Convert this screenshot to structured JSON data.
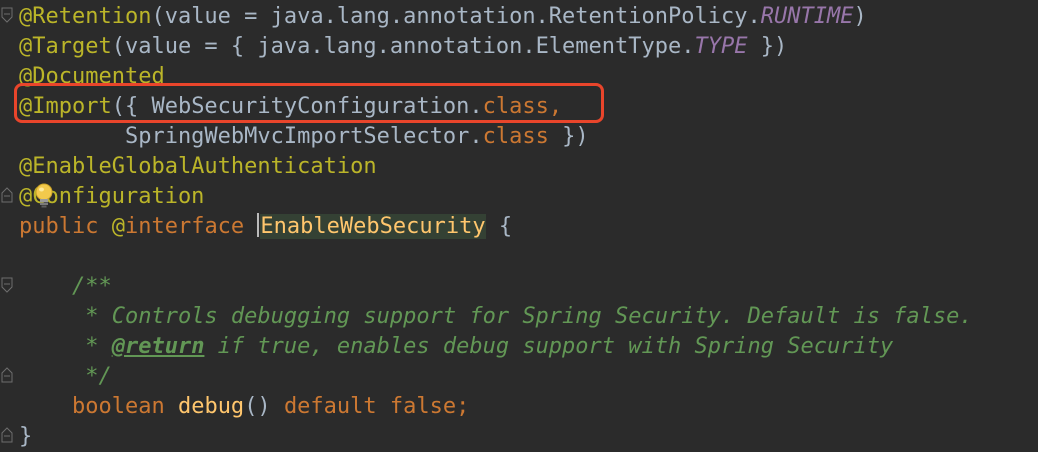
{
  "lines": [
    {
      "parts": [
        {
          "c": "ann",
          "t": "@Retention"
        },
        {
          "c": "plain",
          "t": "(value = java.lang.annotation.RetentionPolicy."
        },
        {
          "c": "const",
          "t": "RUNTIME"
        },
        {
          "c": "plain",
          "t": ")"
        }
      ]
    },
    {
      "parts": [
        {
          "c": "ann",
          "t": "@Target"
        },
        {
          "c": "plain",
          "t": "(value = { java.lang.annotation.ElementType."
        },
        {
          "c": "const",
          "t": "TYPE"
        },
        {
          "c": "plain",
          "t": " })"
        }
      ]
    },
    {
      "parts": [
        {
          "c": "ann",
          "t": "@Documented"
        }
      ]
    },
    {
      "parts": [
        {
          "c": "ann",
          "t": "@Import"
        },
        {
          "c": "plain",
          "t": "({ WebSecurityConfiguration."
        },
        {
          "c": "kw",
          "t": "class"
        },
        {
          "c": "kw",
          "t": ","
        }
      ]
    },
    {
      "parts": [
        {
          "c": "plain",
          "t": "        SpringWebMvcImportSelector."
        },
        {
          "c": "kw",
          "t": "class"
        },
        {
          "c": "plain",
          "t": " })"
        }
      ]
    },
    {
      "parts": [
        {
          "c": "ann",
          "t": "@EnableGlobalAuthentication"
        }
      ]
    },
    {
      "parts": [
        {
          "c": "ann",
          "t": "@Configuration"
        }
      ]
    },
    {
      "parts": [
        {
          "c": "kw",
          "t": "public "
        },
        {
          "c": "ann",
          "t": "@"
        },
        {
          "c": "kw",
          "t": "interface "
        },
        {
          "c": "cursor",
          "t": ""
        },
        {
          "c": "decl-highlight",
          "t": "EnableWebSecurity"
        },
        {
          "c": "plain",
          "t": " {"
        }
      ]
    },
    {
      "parts": [
        {
          "c": "plain",
          "t": ""
        }
      ]
    },
    {
      "parts": [
        {
          "c": "doc",
          "t": "    /**"
        }
      ]
    },
    {
      "parts": [
        {
          "c": "doc",
          "t": "     * Controls debugging support for Spring Security. Default is false."
        }
      ]
    },
    {
      "parts": [
        {
          "c": "doc",
          "t": "     * "
        },
        {
          "c": "doctag",
          "t": "@return"
        },
        {
          "c": "doc",
          "t": " if true, enables debug support with Spring Security"
        }
      ]
    },
    {
      "parts": [
        {
          "c": "doc",
          "t": "     */"
        }
      ]
    },
    {
      "parts": [
        {
          "c": "kw",
          "t": "    boolean "
        },
        {
          "c": "fn",
          "t": "debug"
        },
        {
          "c": "plain",
          "t": "() "
        },
        {
          "c": "kw",
          "t": "default false;"
        }
      ]
    },
    {
      "parts": [
        {
          "c": "plain",
          "t": "}"
        }
      ]
    }
  ],
  "colors": {
    "background": "#2b2b2b",
    "annotation": "#bbb529",
    "keyword": "#cc7832",
    "text": "#a9b7c6",
    "constant": "#9876aa",
    "method": "#ffc66d",
    "doc_comment": "#629755",
    "highlight_box": "#e9452b"
  },
  "icons": {
    "fold": "fold-marker-icon",
    "bulb": "lightbulb-icon"
  }
}
